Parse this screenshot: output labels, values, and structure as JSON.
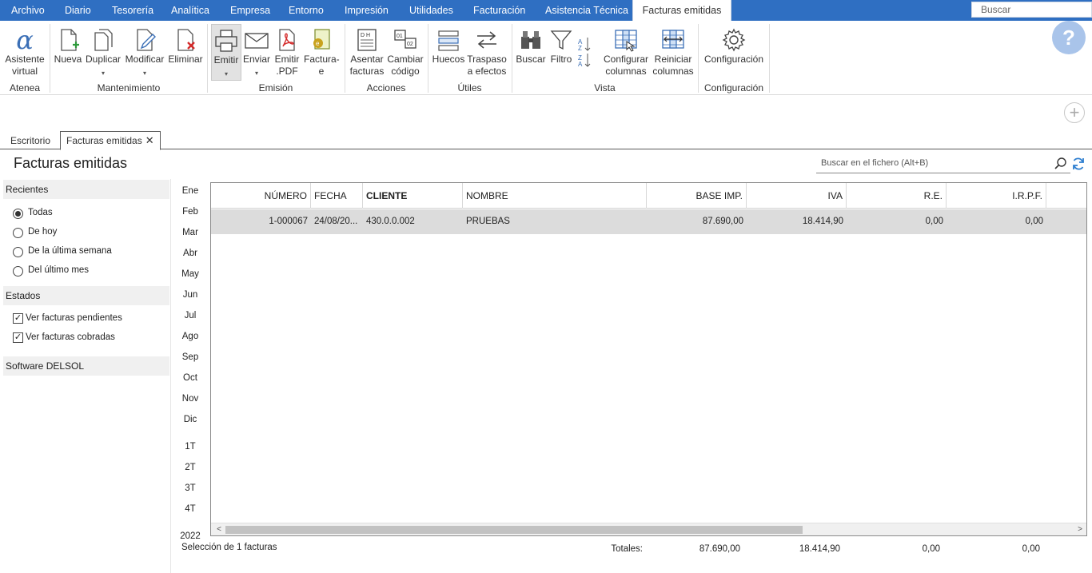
{
  "menu": {
    "items": [
      "Archivo",
      "Diario",
      "Tesorería",
      "Analítica",
      "Empresa",
      "Entorno",
      "Impresión",
      "Utilidades",
      "Facturación",
      "Asistencia Técnica"
    ],
    "active": "Facturas emitidas",
    "search_placeholder": "Buscar"
  },
  "ribbon": {
    "buttons": {
      "asistente": [
        "Asistente",
        "virtual"
      ],
      "nueva": "Nueva",
      "duplicar": "Duplicar",
      "modificar": "Modificar",
      "eliminar": "Eliminar",
      "emitir": "Emitir",
      "enviar": "Enviar",
      "emitir_pdf": [
        "Emitir",
        ".PDF"
      ],
      "facturae": [
        "Factura-",
        "e"
      ],
      "asentar": [
        "Asentar",
        "facturas"
      ],
      "cambiar": [
        "Cambiar",
        "código"
      ],
      "huecos": "Huecos",
      "traspaso": [
        "Traspaso",
        "a efectos"
      ],
      "buscar": "Buscar",
      "filtro": "Filtro",
      "configurar": [
        "Configurar",
        "columnas"
      ],
      "reiniciar": [
        "Reiniciar",
        "columnas"
      ],
      "configuracion": "Configuración"
    },
    "groups": [
      "Atenea",
      "Mantenimiento",
      "Emisión",
      "Acciones",
      "Útiles",
      "Vista",
      "Configuración"
    ]
  },
  "tabs": {
    "escritorio": "Escritorio",
    "active": "Facturas emitidas",
    "close": "✕"
  },
  "page": {
    "title": "Facturas emitidas",
    "search_placeholder": "Buscar en el fichero (Alt+B)"
  },
  "left": {
    "recientes": "Recientes",
    "options": [
      "Todas",
      "De hoy",
      "De la última semana",
      "Del último mes"
    ],
    "selected": "Todas",
    "estados": "Estados",
    "checks": [
      "Ver facturas pendientes",
      "Ver facturas cobradas"
    ],
    "software": "Software DELSOL"
  },
  "months": [
    "Ene",
    "Feb",
    "Mar",
    "Abr",
    "May",
    "Jun",
    "Jul",
    "Ago",
    "Sep",
    "Oct",
    "Nov",
    "Dic"
  ],
  "quarters": [
    "1T",
    "2T",
    "3T",
    "4T"
  ],
  "year": "2022",
  "grid": {
    "columns": [
      "NÚMERO",
      "FECHA",
      "CLIENTE",
      "NOMBRE",
      "BASE IMP.",
      "IVA",
      "R.E.",
      "I.R.P.F."
    ],
    "rows": [
      [
        "1-000067",
        "24/08/20...",
        "430.0.0.002",
        "PRUEBAS",
        "87.690,00",
        "18.414,90",
        "0,00",
        "0,00"
      ]
    ]
  },
  "footer": {
    "selection": "Selección de 1 facturas",
    "totals_label": "Totales:",
    "base": "87.690,00",
    "iva": "18.414,90",
    "re": "0,00",
    "irpf": "0,00"
  }
}
